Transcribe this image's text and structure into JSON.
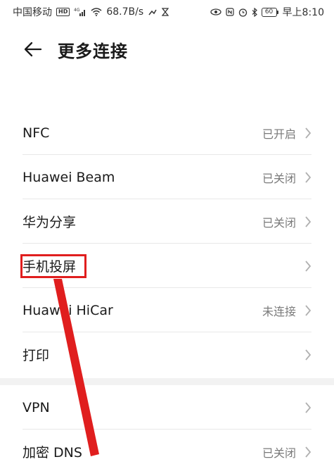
{
  "status_bar": {
    "carrier": "中国移动",
    "hd_badge": "HD",
    "network": "4G",
    "speed": "68.7B/s",
    "battery": "60",
    "time": "早上8:10"
  },
  "header": {
    "title": "更多连接"
  },
  "items_group_1": [
    {
      "label": "NFC",
      "status": "已开启"
    },
    {
      "label": "Huawei Beam",
      "status": "已关闭"
    },
    {
      "label": "华为分享",
      "status": "已关闭"
    },
    {
      "label": "手机投屏",
      "status": ""
    },
    {
      "label": "Huawei HiCar",
      "status": "未连接"
    },
    {
      "label": "打印",
      "status": ""
    }
  ],
  "items_group_2": [
    {
      "label": "VPN",
      "status": ""
    },
    {
      "label": "加密 DNS",
      "status": "已关闭"
    }
  ],
  "colors": {
    "annotation_red": "#e01e1e",
    "divider": "#e8e8e8",
    "status_gray": "#7a7a7a"
  },
  "icons": [
    "back-arrow-icon",
    "chevron-right-icon",
    "signal-icon",
    "wifi-icon",
    "battery-icon",
    "eye-icon",
    "nfc-icon",
    "alarm-icon",
    "bluetooth-icon",
    "hourglass-icon",
    "missed-call-icon"
  ]
}
